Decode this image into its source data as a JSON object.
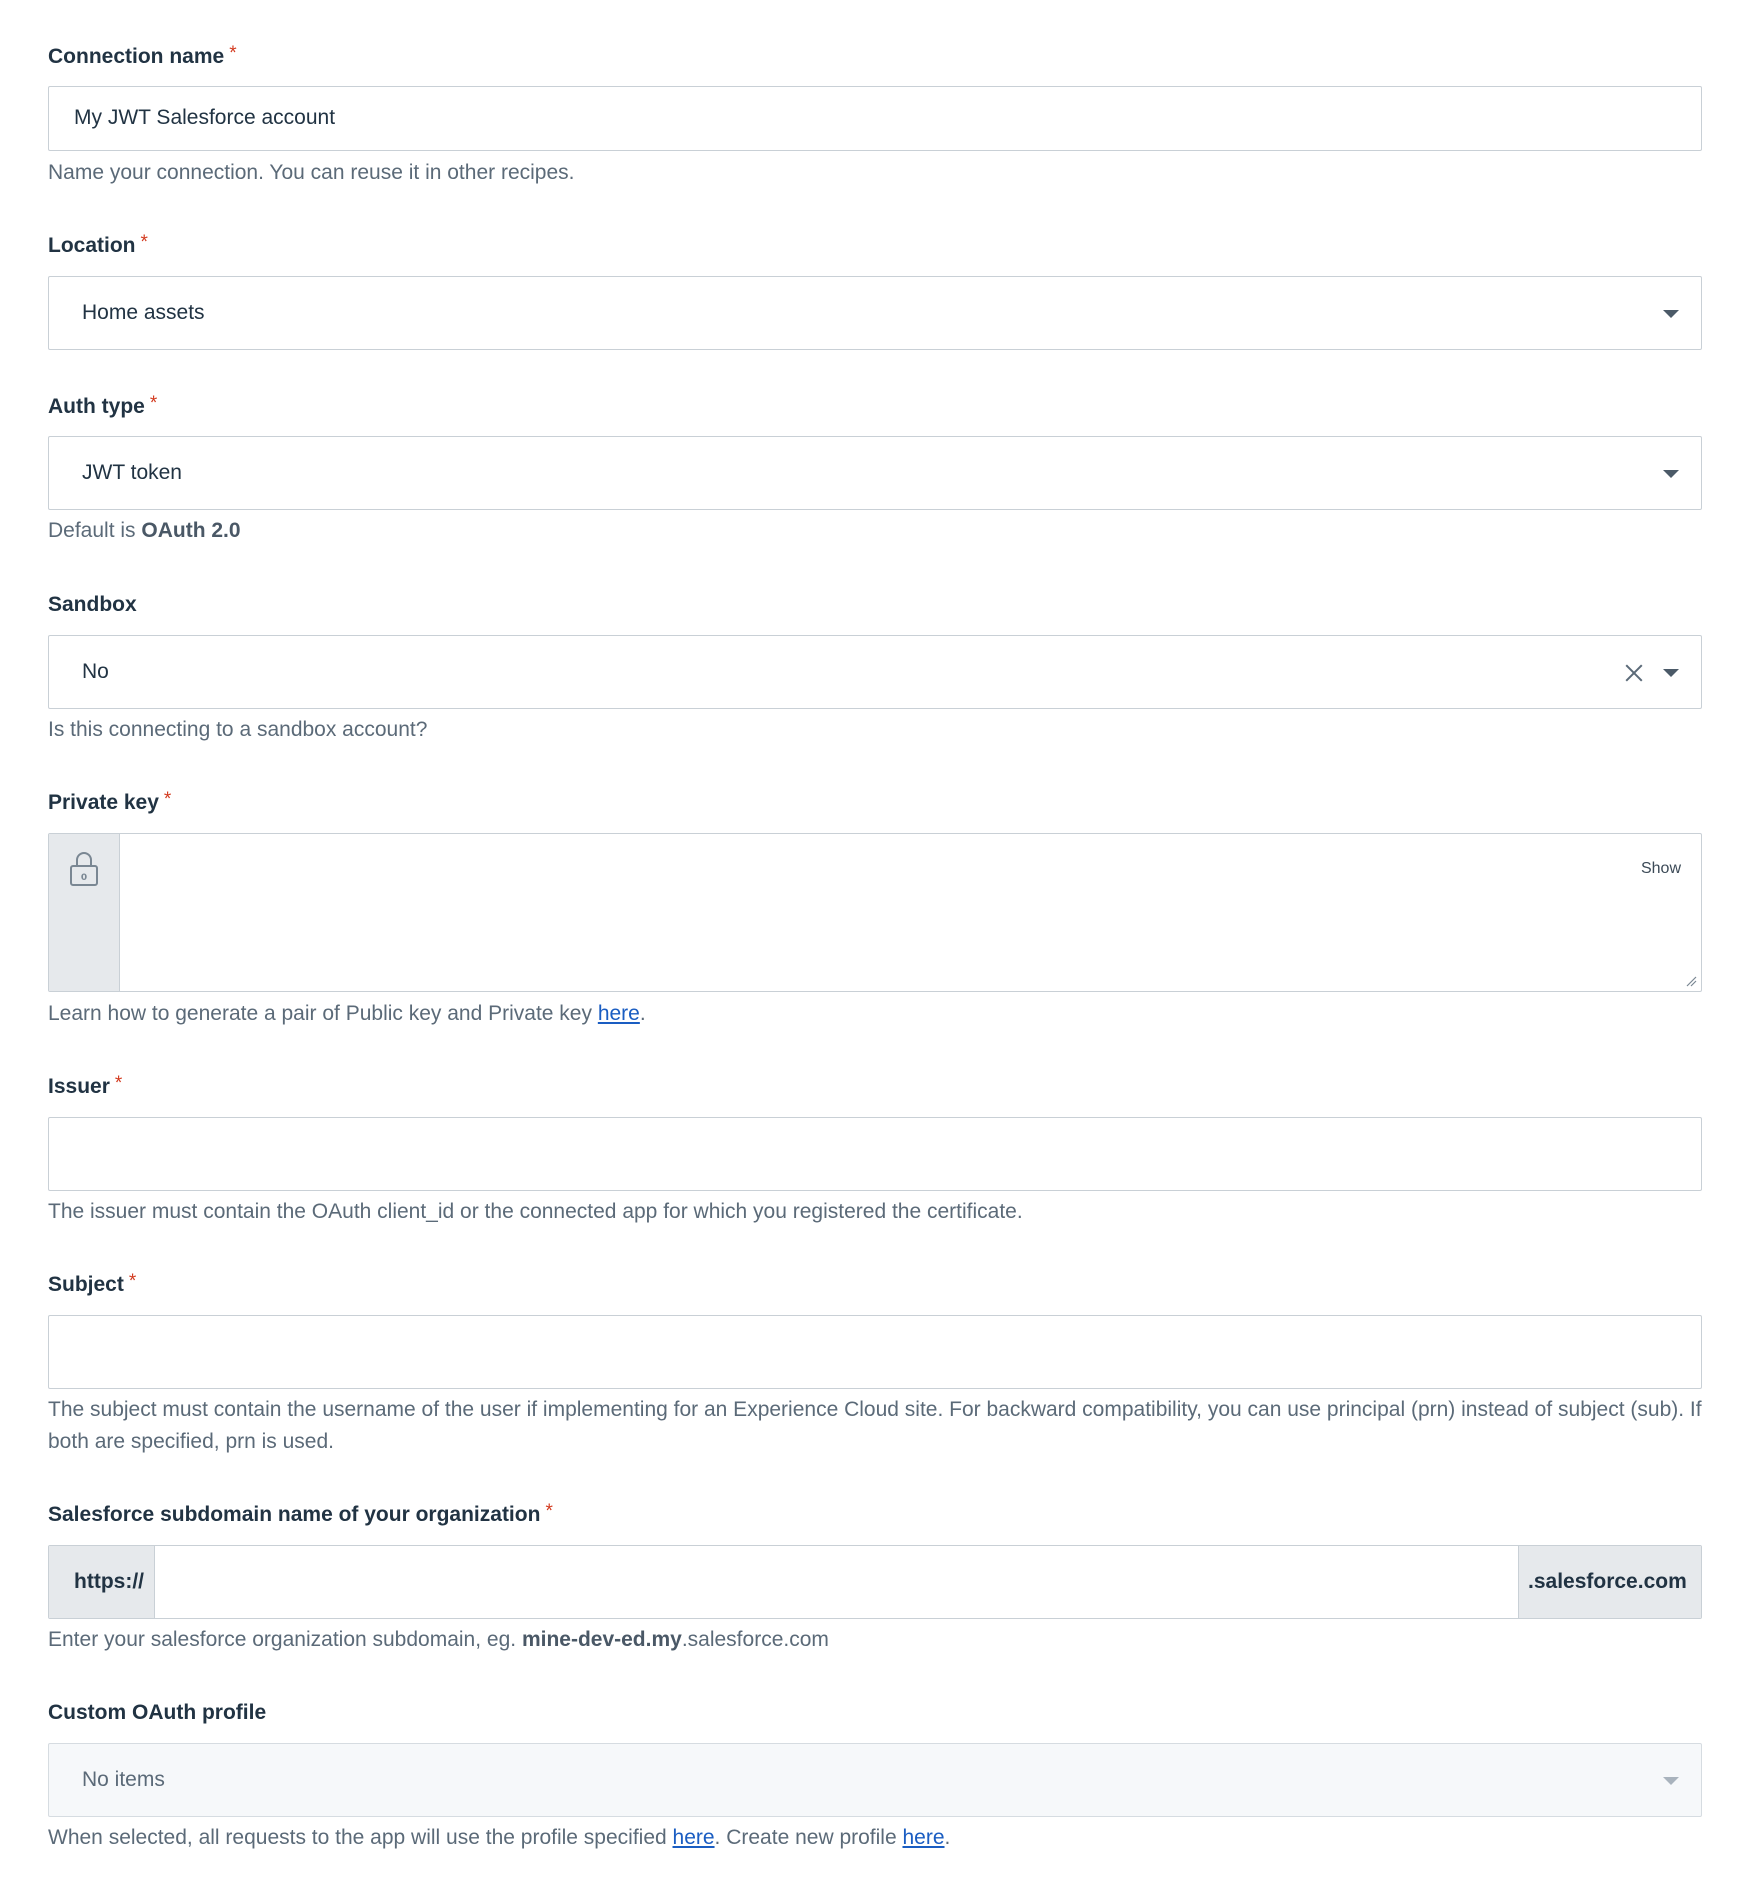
{
  "fields": {
    "connection_name": {
      "label": "Connection name",
      "required_mark": "*",
      "value": "My JWT Salesforce account",
      "hint": "Name your connection. You can reuse it in other recipes."
    },
    "location": {
      "label": "Location",
      "required_mark": "*",
      "value": "Home assets"
    },
    "auth_type": {
      "label": "Auth type",
      "required_mark": "*",
      "value": "JWT token",
      "hint_prefix": "Default is ",
      "hint_bold": "OAuth 2.0"
    },
    "sandbox": {
      "label": "Sandbox",
      "value": "No",
      "hint": "Is this connecting to a sandbox account?"
    },
    "private_key": {
      "label": "Private key",
      "required_mark": "*",
      "value": "",
      "show_label": "Show",
      "hint_prefix": "Learn how to generate a pair of Public key and Private key ",
      "hint_link": "here",
      "hint_suffix": "."
    },
    "issuer": {
      "label": "Issuer",
      "required_mark": "*",
      "value": "",
      "hint": "The issuer must contain the OAuth client_id or the connected app for which you registered the certificate."
    },
    "subject": {
      "label": "Subject",
      "required_mark": "*",
      "value": "",
      "hint_line1": "The subject must contain the username of the user if implementing for an Experience Cloud site. For backward compatibility, you can use principal (prn) instead of subject (sub). If",
      "hint_line2": "both are specified, prn is used."
    },
    "subdomain": {
      "label": "Salesforce subdomain name of your organization",
      "required_mark": "*",
      "prefix": "https://",
      "suffix": ".salesforce.com",
      "value": "",
      "hint_prefix": "Enter your salesforce organization subdomain, eg. ",
      "hint_bold": "mine-dev-ed.my",
      "hint_suffix": ".salesforce.com"
    },
    "custom_oauth_profile": {
      "label": "Custom OAuth profile",
      "value": "No items",
      "hint_prefix": "When selected, all requests to the app will use the profile specified ",
      "hint_link1": "here",
      "hint_middle": ". Create new profile ",
      "hint_link2": "here",
      "hint_suffix": "."
    }
  },
  "icons": {
    "dropdown": "chevron-down-icon",
    "clear": "close-icon",
    "lock": "lock-icon",
    "resize": "resize-handle-icon"
  },
  "colors": {
    "required": "#d33a1f",
    "link": "#1a5dc2",
    "border": "#c9d0d6",
    "addon_bg": "#e6e9ec",
    "disabled_bg": "#f6f8fa"
  }
}
